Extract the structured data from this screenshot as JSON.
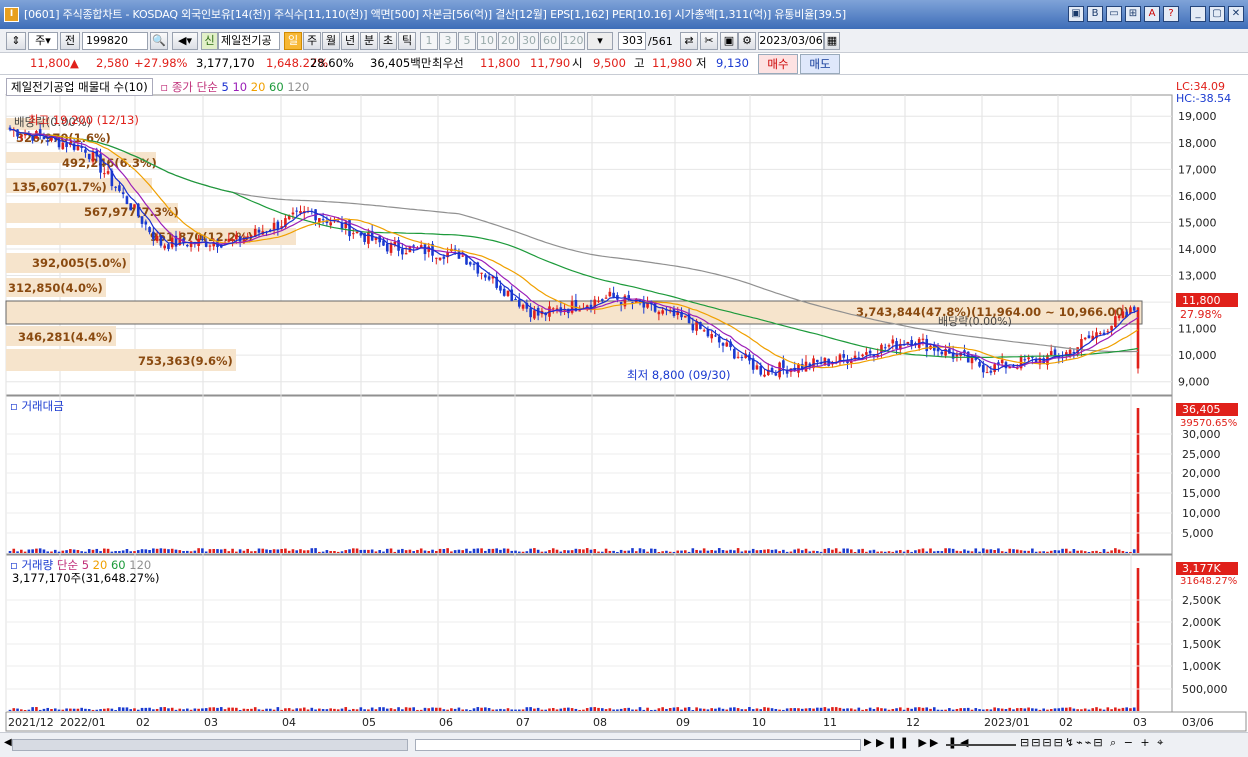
{
  "window": {
    "app_icon": "I",
    "title": "[0601] 주식종합차트 - KOSDAQ 외국인보유[14(천)] 주식수[11,110(천)] 액면[500] 자본금[56(억)] 결산[12월] EPS[1,162] PER[10.16] 시가총액[1,311(억)] 유통비율[39.5]",
    "title_buttons": [
      "▣",
      "B",
      "▭",
      "⊞",
      "A",
      "?"
    ],
    "window_buttons": [
      "_",
      "▢",
      "✕"
    ]
  },
  "toolbar": {
    "type_select": "주",
    "prev_btn": "전",
    "code": "199820",
    "stock_name": "제일전기공",
    "stock_prefix": "신",
    "periods": [
      "일",
      "주",
      "월",
      "년",
      "분",
      "초",
      "틱"
    ],
    "active_period": "일",
    "intervals": [
      "1",
      "3",
      "5",
      "10",
      "20",
      "30",
      "60",
      "120"
    ],
    "count": "303",
    "total": "/561",
    "date": "2023/03/06"
  },
  "quote": {
    "price": "11,800",
    "arrow": "▲",
    "change": "2,580",
    "change_pct": "+27.98%",
    "volume": "3,177,170",
    "volume_pct": "1,648.27%",
    "turnover": "28.60%",
    "amount": "36,405백만",
    "best_label": "최우선",
    "best_ask": "11,800",
    "best_bid": "11,790",
    "open_label": "시",
    "open": "9,500",
    "high_label": "고",
    "high": "11,980",
    "low_label": "저",
    "low": "9,130",
    "buy_label": "매수",
    "sell_label": "매도"
  },
  "price_panel": {
    "title": "제일전기공업 매물대 수(10)",
    "ma_label": "종가 단순",
    "ma_periods": [
      "5",
      "10",
      "20",
      "60",
      "120"
    ],
    "ma_colors": [
      "#1a2fd0",
      "#9b1fb8",
      "#f0a000",
      "#1c9a3a",
      "#909090"
    ],
    "lc": "LC:34.09",
    "hc": "HC:-38.54",
    "y_ticks": [
      "19,000",
      "18,000",
      "17,000",
      "16,000",
      "15,000",
      "14,000",
      "13,000",
      "12,000",
      "11,000",
      "10,000",
      "9,000"
    ],
    "current_price": "11,800",
    "current_pct": "27.98%",
    "dividend_label_top": "배당락(0.00%)",
    "dividend_label_mid": "배당락(0.00%)",
    "high_label": "최고 19,200 (12/13)",
    "low_label": "최저 8,800 (09/30)",
    "vp_highlight": "3,743,844(47.8%)(11,964.00 ~ 10,966.00)",
    "volume_profile": [
      "326,970(1.6%)",
      "492,246(6.3%)",
      "135,607(1.7%)",
      "567,977(7.3%)",
      "951,870(12.2%)",
      "392,005(5.0%)",
      "312,850(4.0%)",
      "346,281(4.4%)",
      "753,363(9.6%)"
    ]
  },
  "amount_panel": {
    "title": "거래대금",
    "y_ticks": [
      "30,000",
      "25,000",
      "20,000",
      "15,000",
      "10,000",
      "5,000"
    ],
    "current": "36,405",
    "current_pct": "39570.65%"
  },
  "volume_panel": {
    "title": "거래량",
    "ma_label": "단순",
    "ma_periods": [
      "5",
      "20",
      "60",
      "120"
    ],
    "sub": "3,177,170주(31,648.27%)",
    "y_ticks": [
      "2,500K",
      "2,000K",
      "1,500K",
      "1,000K",
      "500,000"
    ],
    "current": "3,177K",
    "current_pct": "31648.27%"
  },
  "x_axis": [
    "2021/12",
    "2022/01",
    "02",
    "03",
    "04",
    "05",
    "06",
    "07",
    "08",
    "09",
    "10",
    "11",
    "12",
    "2023/01",
    "02",
    "03",
    "03/06"
  ],
  "chart_data": {
    "type": "candlestick",
    "ylim": [
      8500,
      19800
    ],
    "monthly_closes": {
      "x": [
        "2021/12",
        "2022/01",
        "02",
        "03",
        "04",
        "05",
        "06",
        "07",
        "08",
        "09",
        "10",
        "11",
        "12",
        "2023/01",
        "02",
        "03"
      ],
      "y": [
        18500,
        17800,
        14200,
        14300,
        15400,
        14100,
        13800,
        11500,
        12200,
        11300,
        9400,
        9800,
        10600,
        9500,
        10000,
        11800
      ]
    },
    "last_close": 11800
  },
  "colors": {
    "up": "#e0201a",
    "down": "#1a3ad0",
    "vp": "#f6e4cc",
    "vp_text": "#8a4a10"
  }
}
